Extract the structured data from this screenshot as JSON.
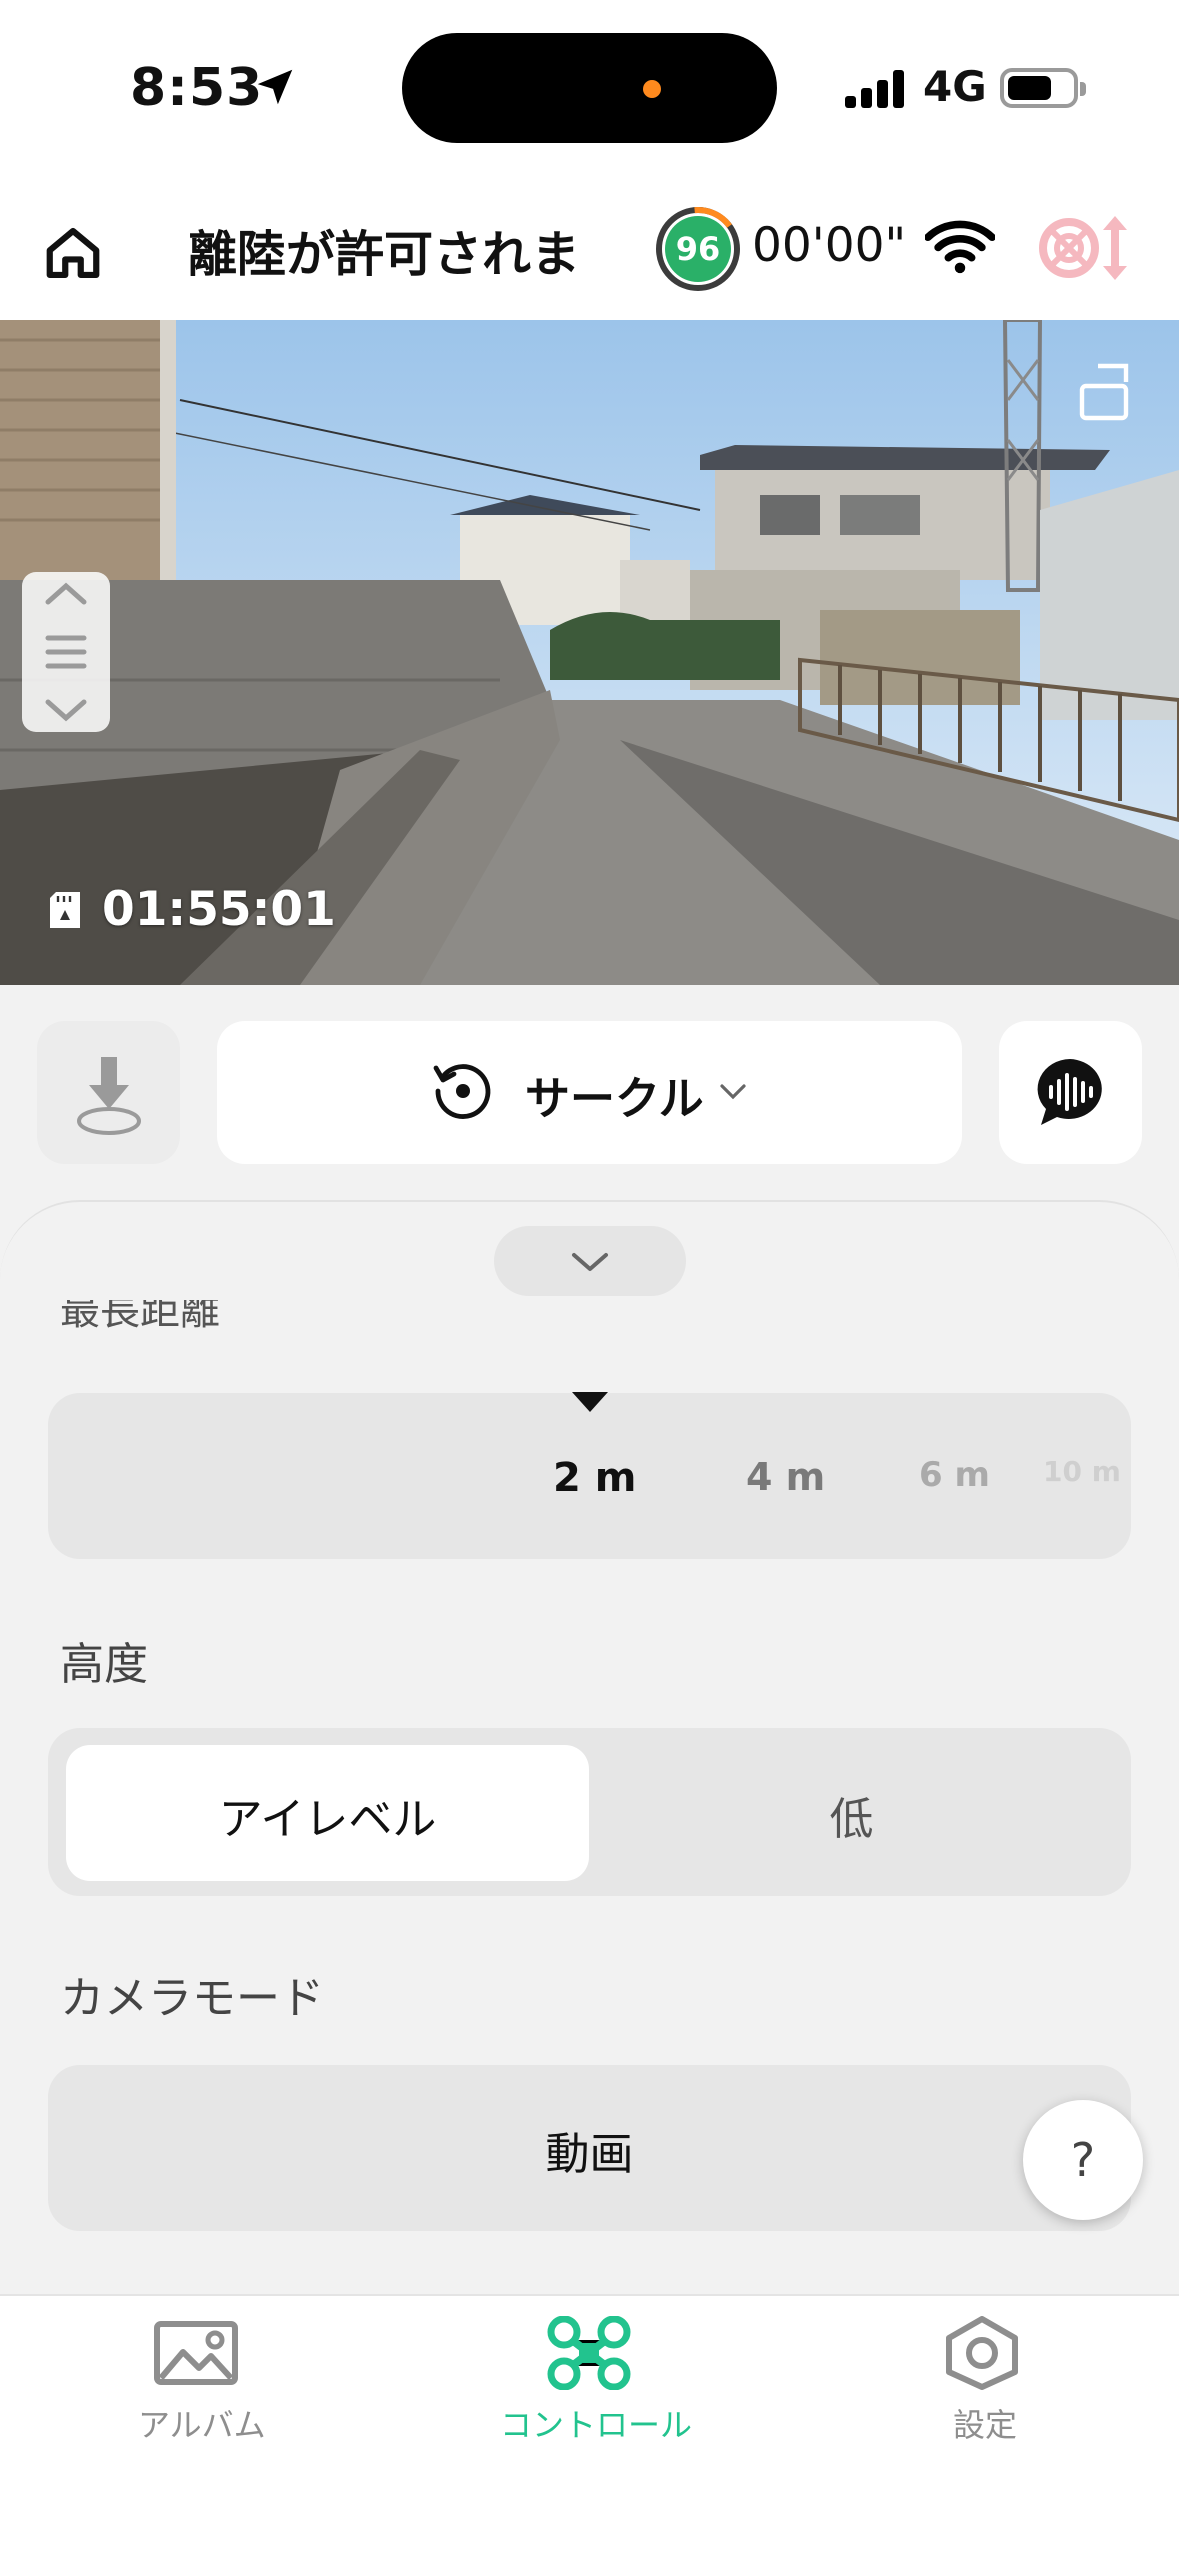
{
  "status_bar": {
    "time": "8:53",
    "network": "4G",
    "battery_level": 0.7
  },
  "header": {
    "title": "離陸が許可されま",
    "drone_battery": "96",
    "flight_time": "00'00\""
  },
  "camera": {
    "recording_remaining": "01:55:01"
  },
  "mode_bar": {
    "mode_label": "サークル"
  },
  "sheet": {
    "clipped_section_label": "最長距離",
    "distance": {
      "ticks": [
        "2 m",
        "4 m",
        "6 m",
        "10 m"
      ],
      "selected": "2 m"
    },
    "height": {
      "label": "高度",
      "options": [
        "アイレベル",
        "低"
      ],
      "selected_index": 0
    },
    "camera_mode": {
      "label": "カメラモード",
      "value": "動画"
    },
    "help_label": "?"
  },
  "tab_bar": {
    "tabs": [
      {
        "label": "アルバム",
        "icon": "photo-album-icon",
        "active": false
      },
      {
        "label": "コントロール",
        "icon": "drone-icon",
        "active": true
      },
      {
        "label": "設定",
        "icon": "hexagon-settings-icon",
        "active": false
      }
    ]
  },
  "colors": {
    "accent": "#22c38e",
    "battery_ring": "#2ab068",
    "warning": "#f5b8bf"
  }
}
